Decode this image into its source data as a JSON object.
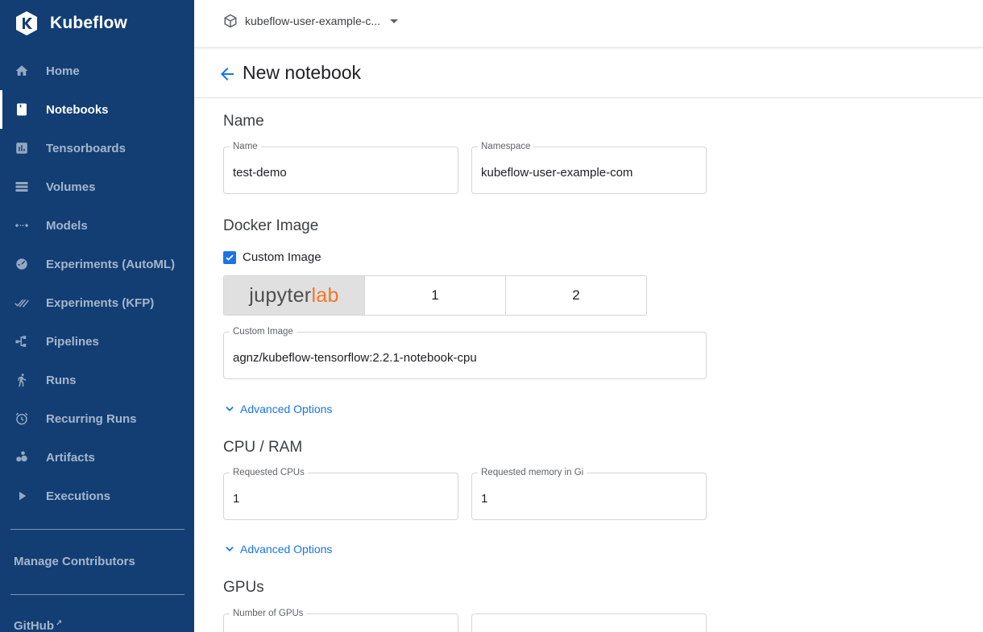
{
  "app": {
    "brand": "Kubeflow",
    "namespace_selector": "kubeflow-user-example-c...",
    "colors": {
      "sidebar": "#123e74",
      "accent": "#1a73e8",
      "jupyterlab_orange": "#f37726"
    }
  },
  "sidebar": {
    "items": [
      {
        "label": "Home",
        "icon": "home-icon"
      },
      {
        "label": "Notebooks",
        "icon": "notebook-icon",
        "active": true
      },
      {
        "label": "Tensorboards",
        "icon": "chart-icon"
      },
      {
        "label": "Volumes",
        "icon": "storage-icon"
      },
      {
        "label": "Models",
        "icon": "code-arrows-icon"
      },
      {
        "label": "Experiments (AutoML)",
        "icon": "speedometer-icon"
      },
      {
        "label": "Experiments (KFP)",
        "icon": "double-check-icon"
      },
      {
        "label": "Pipelines",
        "icon": "pipeline-icon"
      },
      {
        "label": "Runs",
        "icon": "run-icon"
      },
      {
        "label": "Recurring Runs",
        "icon": "alarm-icon"
      },
      {
        "label": "Artifacts",
        "icon": "bubbles-icon"
      },
      {
        "label": "Executions",
        "icon": "play-icon"
      }
    ],
    "manage_contributors": "Manage Contributors",
    "github": "GitHub"
  },
  "page": {
    "title": "New notebook"
  },
  "form": {
    "name_section": "Name",
    "name": {
      "label": "Name",
      "value": "test-demo"
    },
    "namespace": {
      "label": "Namespace",
      "value": "kubeflow-user-example-com"
    },
    "docker_section": "Docker Image",
    "custom_image_checkbox": "Custom Image",
    "custom_image_checked": true,
    "image_options": {
      "jupyter": "jupyter",
      "lab": "lab",
      "option_2": "1",
      "option_3": "2"
    },
    "custom_image": {
      "label": "Custom Image",
      "value": "agnz/kubeflow-tensorflow:2.2.1-notebook-cpu"
    },
    "advanced_options": "Advanced Options",
    "cpu_section": "CPU / RAM",
    "cpus": {
      "label": "Requested CPUs",
      "value": "1"
    },
    "memory": {
      "label": "Requested memory in Gi",
      "value": "1"
    },
    "advanced_options_2": "Advanced Options",
    "gpu_section": "GPUs",
    "gpus": {
      "label": "Number of GPUs"
    }
  }
}
